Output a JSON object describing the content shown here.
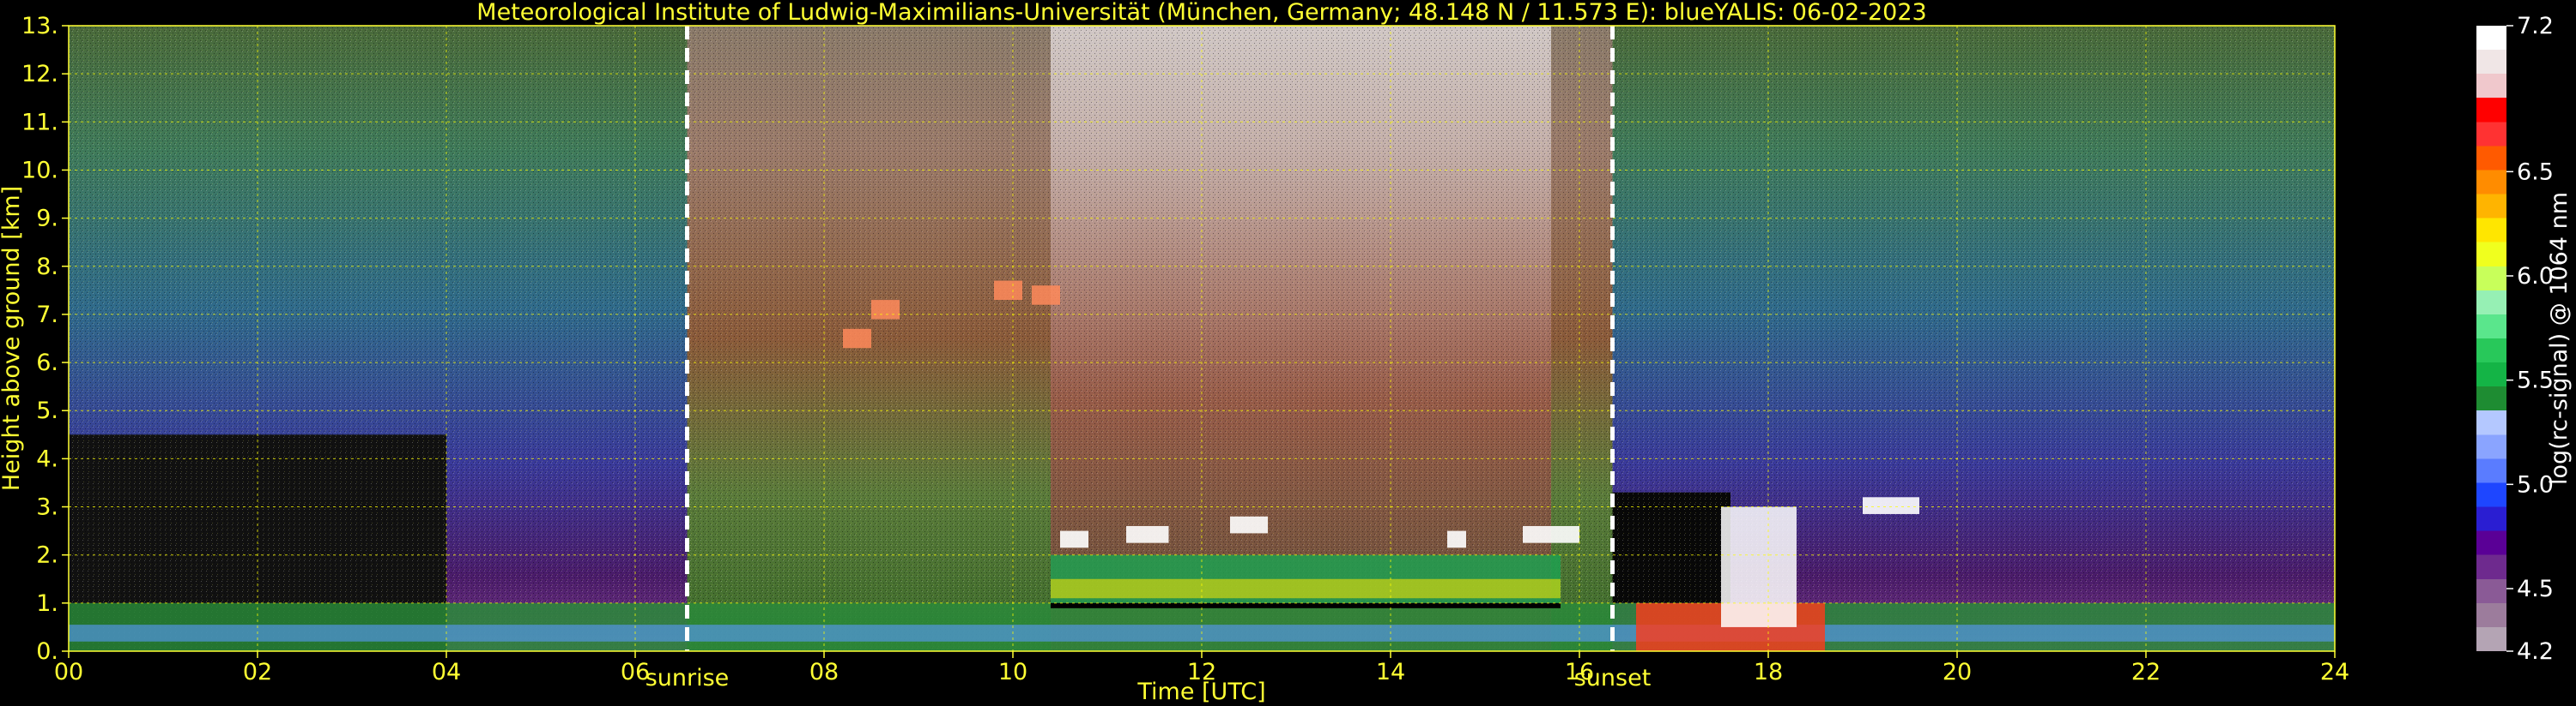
{
  "chart_data": {
    "type": "heatmap",
    "title": "Meteorological Institute of Ludwig-Maximilians-Universität (München, Germany; 48.148 N / 11.573 E):     blueYALIS: 06-02-2023",
    "xlabel": "Time [UTC]",
    "ylabel": "Height above ground [km]",
    "xlim": [
      0,
      24
    ],
    "ylim": [
      0,
      13
    ],
    "x_ticks": [
      "00",
      "02",
      "04",
      "06",
      "08",
      "10",
      "12",
      "14",
      "16",
      "18",
      "20",
      "22",
      "24"
    ],
    "x_tick_values": [
      0,
      2,
      4,
      6,
      8,
      10,
      12,
      14,
      16,
      18,
      20,
      22,
      24
    ],
    "y_ticks": [
      "0.",
      "1.",
      "2.",
      "3.",
      "4.",
      "5.",
      "6.",
      "7.",
      "8.",
      "9.",
      "10.",
      "11.",
      "12.",
      "13."
    ],
    "y_tick_values": [
      0,
      1,
      2,
      3,
      4,
      5,
      6,
      7,
      8,
      9,
      10,
      11,
      12,
      13
    ],
    "grid": true,
    "grid_color": "#ffff00",
    "annotations": [
      {
        "label": "sunrise",
        "x": 6.55
      },
      {
        "label": "sunset",
        "x": 16.35
      }
    ],
    "colorbar": {
      "label": "log(rc-signal) @ 1064 nm",
      "min": 4.2,
      "max": 7.2,
      "ticks": [
        "4.2",
        "4.5",
        "5.0",
        "5.5",
        "6.0",
        "6.5",
        "7.2"
      ],
      "tick_values": [
        4.2,
        4.5,
        5.0,
        5.5,
        6.0,
        6.5,
        7.2
      ],
      "colors": [
        "#b4a4b4",
        "#9c7c9c",
        "#8a5a96",
        "#6e2a8e",
        "#5a0096",
        "#2a1ed2",
        "#1e46ff",
        "#5a7cff",
        "#8aa4ff",
        "#b4c8ff",
        "#1e8c32",
        "#14b446",
        "#28c85a",
        "#5ae68c",
        "#96f0b4",
        "#c8ff5a",
        "#f0ff1e",
        "#ffe600",
        "#ffb400",
        "#ff8c00",
        "#ff5a00",
        "#ff3232",
        "#ff0000",
        "#f0c8cc",
        "#f0e6e6",
        "#ffffff"
      ]
    }
  }
}
